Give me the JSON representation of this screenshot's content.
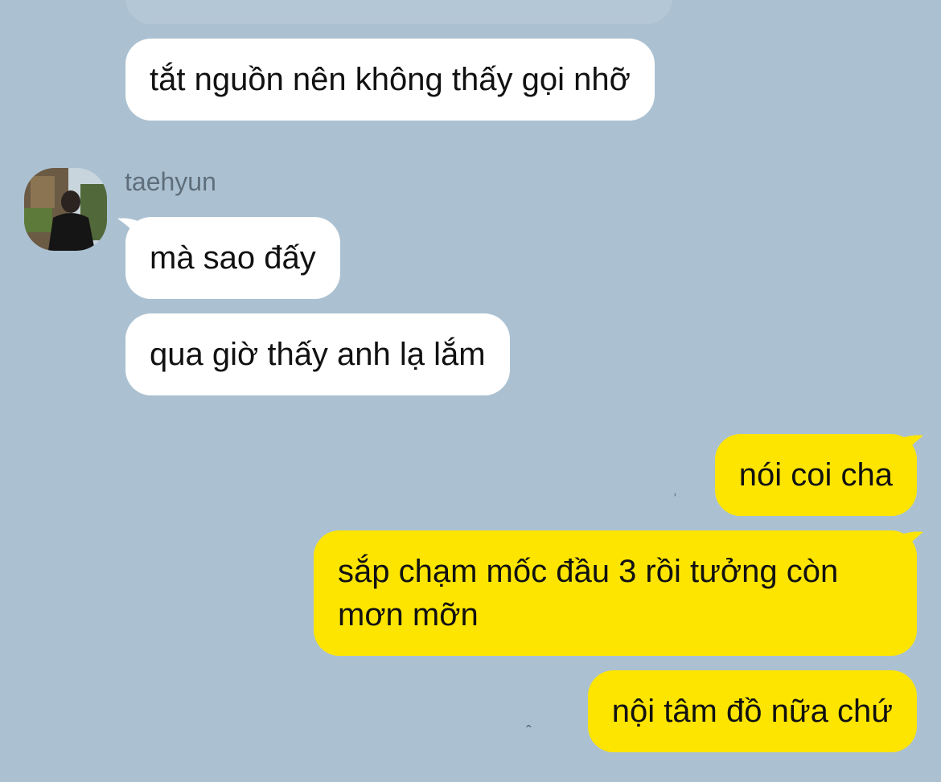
{
  "conversation": {
    "contact_name": "taehyun",
    "messages": [
      {
        "direction": "incoming",
        "text": "tắt nguồn nên không thấy gọi nhỡ"
      },
      {
        "direction": "incoming",
        "text": "mà sao đấy"
      },
      {
        "direction": "incoming",
        "text": "qua giờ thấy anh lạ lắm"
      },
      {
        "direction": "outgoing",
        "text": "nói coi cha"
      },
      {
        "direction": "outgoing",
        "text": "sắp chạm mốc đầu 3 rồi tưởng còn mơn mỡn"
      },
      {
        "direction": "outgoing",
        "text": "nội tâm đồ nữa chứ"
      }
    ]
  },
  "colors": {
    "background": "#abc1d1",
    "incoming_bubble": "#ffffff",
    "outgoing_bubble": "#fee500"
  },
  "icons": {
    "avatar": "profile-photo-avatar"
  }
}
